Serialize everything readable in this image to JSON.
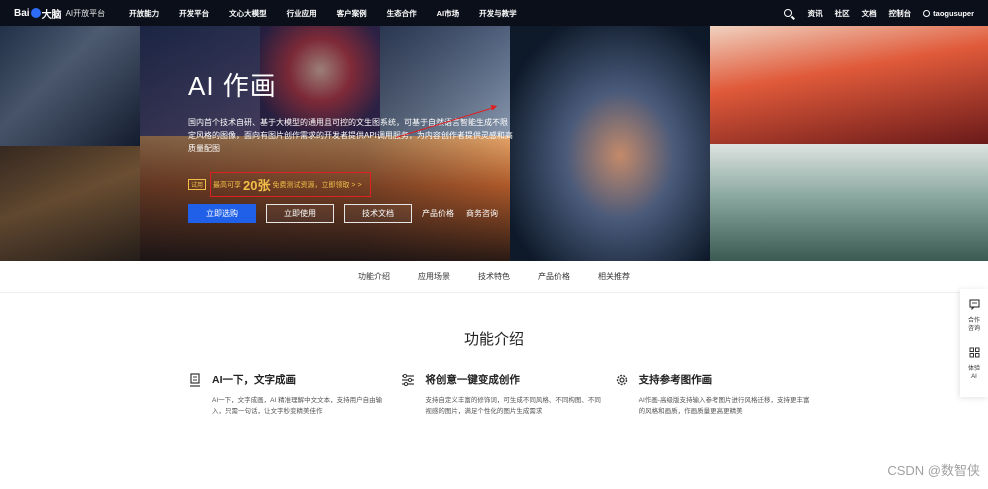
{
  "nav": {
    "logo_text": "Bai",
    "logo_mid": "大脑",
    "logo_sub": "AI开放平台",
    "items": [
      "开放能力",
      "开发平台",
      "文心大模型",
      "行业应用",
      "客户案例",
      "生态合作",
      "AI市场",
      "开发与教学"
    ],
    "right": [
      "资讯",
      "社区",
      "文档",
      "控制台"
    ],
    "username": "taogusuper"
  },
  "hero": {
    "title": "AI 作画",
    "description": "国内首个技术自研、基于大模型的通用且可控的文生图系统，可基于自然语言智能生成不限定风格的图像，面向有图片创作需求的开发者提供API调用服务，为内容创作者提供灵感和高质量配图",
    "promo_tag": "试用",
    "promo_pre": "最高可享",
    "promo_num": "20张",
    "promo_post": "免费测试资源，立即领取 > >",
    "buttons": {
      "primary": "立即选购",
      "use": "立即使用",
      "docs": "技术文档",
      "price": "产品价格",
      "consult": "商务咨询"
    }
  },
  "subnav": [
    "功能介绍",
    "应用场景",
    "技术特色",
    "产品价格",
    "相关推荐"
  ],
  "section": {
    "title": "功能介绍",
    "features": [
      {
        "title": "AI一下，文字成画",
        "desc": "AI一下，文字成画，AI 精准理解中文文本，支持用户自由输入，只需一句话，让文字秒变精美佳作"
      },
      {
        "title": "将创意一键变成创作",
        "desc": "支持自定义丰富的修饰词，可生成不同风格、不同构图、不同视感的图片，满足个性化的图片生成需求"
      },
      {
        "title": "支持参考图作画",
        "desc": "AI作画-高级版支持输入参考图片进行风格迁移，支持更丰富的风格和画质，作画质量更高更精美"
      }
    ]
  },
  "floatbar": {
    "consult": "合作咨询",
    "trial": "体验AI"
  },
  "watermark": "CSDN @数智侠",
  "colors": {
    "nav_bg": "#0b0f1a",
    "primary": "#2060e8",
    "promo": "#f2c04a",
    "annotation": "#e02020"
  }
}
